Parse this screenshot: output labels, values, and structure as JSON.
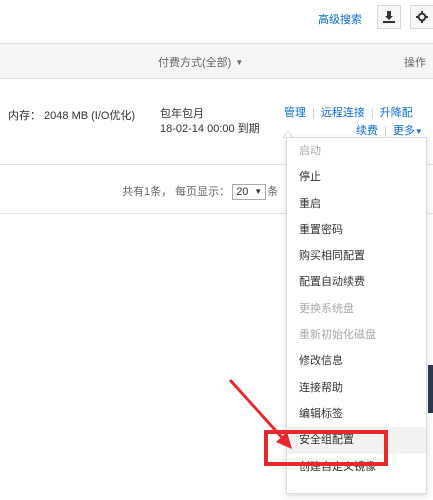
{
  "topbar": {
    "advanced_search": "高级搜索",
    "download_icon": "download-icon",
    "settings_icon": "gear-icon"
  },
  "table": {
    "header": {
      "payment_method": "付费方式(全部)",
      "operations": "操作"
    },
    "row": {
      "memory": "内存： 2048 MB (I/O优化)",
      "billing_type": "包年包月",
      "expiry": "18-02-14 00:00 到期",
      "actions": {
        "manage": "管理",
        "remote_connect": "远程连接",
        "upgrade": "升降配",
        "renew": "续费",
        "more": "更多"
      }
    },
    "pagination": {
      "prefix": "共有1条， 每页显示：",
      "page_size": "20",
      "suffix": "条"
    }
  },
  "more_menu": {
    "items": [
      {
        "label": "启动",
        "disabled": true
      },
      {
        "label": "停止",
        "disabled": false
      },
      {
        "label": "重启",
        "disabled": false
      },
      {
        "label": "重置密码",
        "disabled": false
      },
      {
        "label": "购买相同配置",
        "disabled": false
      },
      {
        "label": "配置自动续费",
        "disabled": false
      },
      {
        "label": "更换系统盘",
        "disabled": true
      },
      {
        "label": "重新初始化磁盘",
        "disabled": true
      },
      {
        "label": "修改信息",
        "disabled": false
      },
      {
        "label": "连接帮助",
        "disabled": false
      },
      {
        "label": "编辑标签",
        "disabled": false
      },
      {
        "label": "安全组配置",
        "disabled": false,
        "highlighted": true
      },
      {
        "label": "创建自定义镜像",
        "disabled": false
      }
    ]
  },
  "annotation": {
    "box_color": "#e8282c",
    "arrow_color": "#e8282c"
  },
  "colors": {
    "link": "#0a6cd6",
    "header_bg": "#f5f5f5",
    "disabled_text": "#aaaaaa"
  }
}
